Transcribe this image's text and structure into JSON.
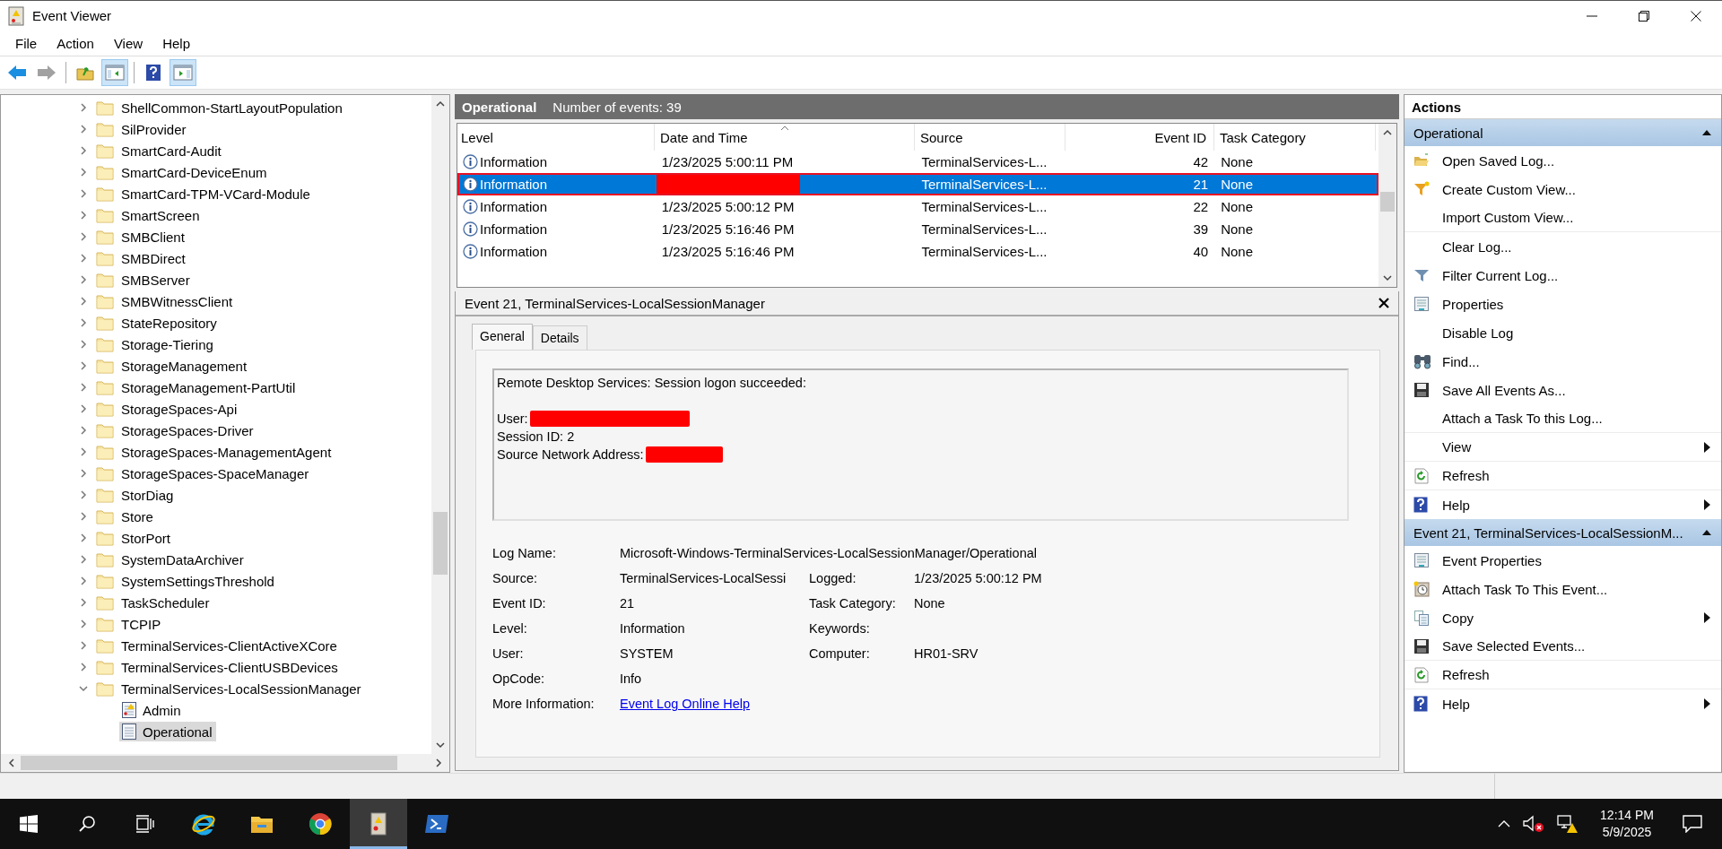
{
  "window": {
    "title": "Event Viewer"
  },
  "menu": [
    "File",
    "Action",
    "View",
    "Help"
  ],
  "toolbar": [
    {
      "kind": "back",
      "pressed": false,
      "disabled": false
    },
    {
      "kind": "forward",
      "pressed": false,
      "disabled": true
    },
    {
      "kind": "up",
      "pressed": false,
      "disabled": false
    },
    {
      "kind": "tree",
      "pressed": true,
      "disabled": false
    },
    {
      "kind": "help",
      "pressed": false,
      "disabled": false
    },
    {
      "kind": "actionpane",
      "pressed": true,
      "disabled": false
    }
  ],
  "tree": {
    "items": [
      {
        "label": "ShellCommon-StartLayoutPopulation",
        "kind": "folder",
        "expanded": false
      },
      {
        "label": "SilProvider",
        "kind": "folder",
        "expanded": false
      },
      {
        "label": "SmartCard-Audit",
        "kind": "folder",
        "expanded": false
      },
      {
        "label": "SmartCard-DeviceEnum",
        "kind": "folder",
        "expanded": false
      },
      {
        "label": "SmartCard-TPM-VCard-Module",
        "kind": "folder",
        "expanded": false
      },
      {
        "label": "SmartScreen",
        "kind": "folder",
        "expanded": false
      },
      {
        "label": "SMBClient",
        "kind": "folder",
        "expanded": false
      },
      {
        "label": "SMBDirect",
        "kind": "folder",
        "expanded": false
      },
      {
        "label": "SMBServer",
        "kind": "folder",
        "expanded": false
      },
      {
        "label": "SMBWitnessClient",
        "kind": "folder",
        "expanded": false
      },
      {
        "label": "StateRepository",
        "kind": "folder",
        "expanded": false
      },
      {
        "label": "Storage-Tiering",
        "kind": "folder",
        "expanded": false
      },
      {
        "label": "StorageManagement",
        "kind": "folder",
        "expanded": false
      },
      {
        "label": "StorageManagement-PartUtil",
        "kind": "folder",
        "expanded": false
      },
      {
        "label": "StorageSpaces-Api",
        "kind": "folder",
        "expanded": false
      },
      {
        "label": "StorageSpaces-Driver",
        "kind": "folder",
        "expanded": false
      },
      {
        "label": "StorageSpaces-ManagementAgent",
        "kind": "folder",
        "expanded": false
      },
      {
        "label": "StorageSpaces-SpaceManager",
        "kind": "folder",
        "expanded": false
      },
      {
        "label": "StorDiag",
        "kind": "folder",
        "expanded": false
      },
      {
        "label": "Store",
        "kind": "folder",
        "expanded": false
      },
      {
        "label": "StorPort",
        "kind": "folder",
        "expanded": false
      },
      {
        "label": "SystemDataArchiver",
        "kind": "folder",
        "expanded": false
      },
      {
        "label": "SystemSettingsThreshold",
        "kind": "folder",
        "expanded": false
      },
      {
        "label": "TaskScheduler",
        "kind": "folder",
        "expanded": false
      },
      {
        "label": "TCPIP",
        "kind": "folder",
        "expanded": false
      },
      {
        "label": "TerminalServices-ClientActiveXCore",
        "kind": "folder",
        "expanded": false
      },
      {
        "label": "TerminalServices-ClientUSBDevices",
        "kind": "folder",
        "expanded": false
      },
      {
        "label": "TerminalServices-LocalSessionManager",
        "kind": "folder",
        "expanded": true,
        "children": [
          {
            "label": "Admin",
            "kind": "admin-log",
            "selected": false
          },
          {
            "label": "Operational",
            "kind": "log",
            "selected": true
          }
        ]
      }
    ]
  },
  "events": {
    "title": "Operational",
    "count_label": "Number of events: 39",
    "columns": [
      {
        "label": "Level",
        "sorted": false
      },
      {
        "label": "Date and Time",
        "sorted": true
      },
      {
        "label": "Source",
        "sorted": false
      },
      {
        "label": "Event ID",
        "sorted": false
      },
      {
        "label": "Task Category",
        "sorted": false
      }
    ],
    "rows": [
      {
        "level": "Information",
        "date": "1/23/2025 5:00:11 PM",
        "source": "TerminalServices-L...",
        "event_id": "42",
        "task_category": "None",
        "selected": false,
        "outlined": false,
        "redacted": false
      },
      {
        "level": "Information",
        "source": "TerminalServices-L...",
        "event_id": "21",
        "task_category": "None",
        "selected": true,
        "outlined": true,
        "redacted": true
      },
      {
        "level": "Information",
        "date": "1/23/2025 5:00:12 PM",
        "source": "TerminalServices-L...",
        "event_id": "22",
        "task_category": "None",
        "selected": false,
        "outlined": false,
        "redacted": false
      },
      {
        "level": "Information",
        "date": "1/23/2025 5:16:46 PM",
        "source": "TerminalServices-L...",
        "event_id": "39",
        "task_category": "None",
        "selected": false,
        "outlined": false,
        "redacted": false
      },
      {
        "level": "Information",
        "date": "1/23/2025 5:16:46 PM",
        "source": "TerminalServices-L...",
        "event_id": "40",
        "task_category": "None",
        "selected": false,
        "outlined": false,
        "redacted": false
      }
    ]
  },
  "detail": {
    "title": "Event 21, TerminalServices-LocalSessionManager",
    "tabs": [
      {
        "label": "General",
        "selected": true
      },
      {
        "label": "Details",
        "selected": false
      }
    ],
    "message": [
      {
        "text": "Remote Desktop Services: Session logon succeeded:",
        "redacted": false,
        "gap_before": false
      },
      {
        "text": "User:",
        "redacted": true,
        "gap_before": true
      },
      {
        "text": "Session ID: 2",
        "redacted": false,
        "gap_before": false
      },
      {
        "text": "Source Network Address:",
        "redacted": true,
        "gap_before": false
      }
    ],
    "fields": [
      [
        {
          "label": "Log Name:",
          "value": "Microsoft-Windows-TerminalServices-LocalSessionManager/Operational",
          "kind": "text"
        }
      ],
      [
        {
          "label": "Source:",
          "value": "TerminalServices-LocalSessi",
          "kind": "text"
        },
        {
          "label": "Logged:",
          "value": "1/23/2025 5:00:12 PM",
          "kind": "text"
        }
      ],
      [
        {
          "label": "Event ID:",
          "value": "21",
          "kind": "text"
        },
        {
          "label": "Task Category:",
          "value": "None",
          "kind": "text"
        }
      ],
      [
        {
          "label": "Level:",
          "value": "Information",
          "kind": "text"
        },
        {
          "label": "Keywords:",
          "kind": "text"
        }
      ],
      [
        {
          "label": "User:",
          "value": "SYSTEM",
          "kind": "text"
        },
        {
          "label": "Computer:",
          "value": "HR01-SRV",
          "kind": "text"
        }
      ],
      [
        {
          "label": "OpCode:",
          "value": "Info",
          "kind": "text"
        }
      ],
      [
        {
          "label": "More Information:",
          "value": "Event Log Online Help",
          "kind": "link"
        }
      ]
    ]
  },
  "actions": {
    "title": "Actions",
    "sections": [
      {
        "title": "Operational",
        "expanded": true,
        "items": [
          {
            "label": "Open Saved Log...",
            "kind": "open",
            "submenu": false,
            "divider": false
          },
          {
            "label": "Create Custom View...",
            "kind": "create",
            "submenu": false,
            "divider": false
          },
          {
            "label": "Import Custom View...",
            "submenu": false,
            "divider": true
          },
          {
            "label": "Clear Log...",
            "submenu": false,
            "divider": false
          },
          {
            "label": "Filter Current Log...",
            "kind": "filter",
            "submenu": false,
            "divider": false
          },
          {
            "label": "Properties",
            "kind": "properties",
            "submenu": false,
            "divider": false
          },
          {
            "label": "Disable Log",
            "submenu": false,
            "divider": false
          },
          {
            "label": "Find...",
            "kind": "find",
            "submenu": false,
            "divider": false
          },
          {
            "label": "Save All Events As...",
            "kind": "save",
            "submenu": false,
            "divider": false
          },
          {
            "label": "Attach a Task To this Log...",
            "submenu": false,
            "divider": true
          },
          {
            "label": "View",
            "submenu": true,
            "divider": true
          },
          {
            "label": "Refresh",
            "kind": "refresh",
            "submenu": false,
            "divider": true
          },
          {
            "label": "Help",
            "kind": "help",
            "submenu": true,
            "divider": false
          }
        ]
      },
      {
        "title": "Event 21, TerminalServices-LocalSessionM...",
        "expanded": true,
        "items": [
          {
            "label": "Event Properties",
            "kind": "properties",
            "submenu": false,
            "divider": false
          },
          {
            "label": "Attach Task To This Event...",
            "kind": "task",
            "submenu": false,
            "divider": false
          },
          {
            "label": "Copy",
            "kind": "copy",
            "submenu": true,
            "divider": false
          },
          {
            "label": "Save Selected Events...",
            "kind": "save",
            "submenu": false,
            "divider": true
          },
          {
            "label": "Refresh",
            "kind": "refresh",
            "submenu": false,
            "divider": true
          },
          {
            "label": "Help",
            "kind": "help",
            "submenu": true,
            "divider": false
          }
        ]
      }
    ]
  },
  "taskbar": {
    "apps": [
      {
        "kind": "start",
        "active": false
      },
      {
        "kind": "search",
        "active": false
      },
      {
        "kind": "taskview",
        "active": false
      },
      {
        "kind": "ie",
        "active": false
      },
      {
        "kind": "explorer",
        "active": false
      },
      {
        "kind": "chrome",
        "active": false
      },
      {
        "kind": "eventviewer",
        "active": true
      },
      {
        "kind": "shell",
        "active": false
      }
    ],
    "time": "12:14 PM",
    "date": "5/9/2025"
  }
}
